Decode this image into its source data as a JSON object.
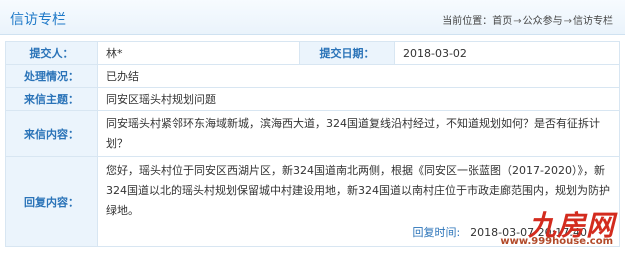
{
  "header": {
    "title": "信访专栏",
    "breadcrumb_prefix": "当前位置：",
    "breadcrumb": [
      "首页",
      "公众参与",
      "信访专栏"
    ],
    "breadcrumb_sep": "→"
  },
  "form": {
    "submitter_label": "提交人：",
    "submitter_value": "林*",
    "submit_date_label": "提交日期：",
    "submit_date_value": "2018-03-02",
    "status_label": "处理情况：",
    "status_value": "已办结",
    "subject_label": "来信主题：",
    "subject_value": "同安区瑶头村规划问题",
    "content_label": "来信内容：",
    "content_value": "同安瑶头村紧邻环东海域新城，滨海西大道，324国道复线沿村经过，不知道规划如何？是否有征拆计划？",
    "reply_label": "回复内容：",
    "reply_value": "您好，瑶头村位于同安区西湖片区，新324国道南北两侧，根据《同安区一张蓝图（2017-2020）》，新324国道以北的瑶头村规划保留城中村建设用地，新324国道以南村庄位于市政走廊范围内，规划为防护绿地。",
    "reply_time_label": "回复时间:",
    "reply_time_value": "2018-03-07 20:17:40"
  },
  "watermark": {
    "logo_text": "九房网",
    "url": "www.999house.com"
  }
}
